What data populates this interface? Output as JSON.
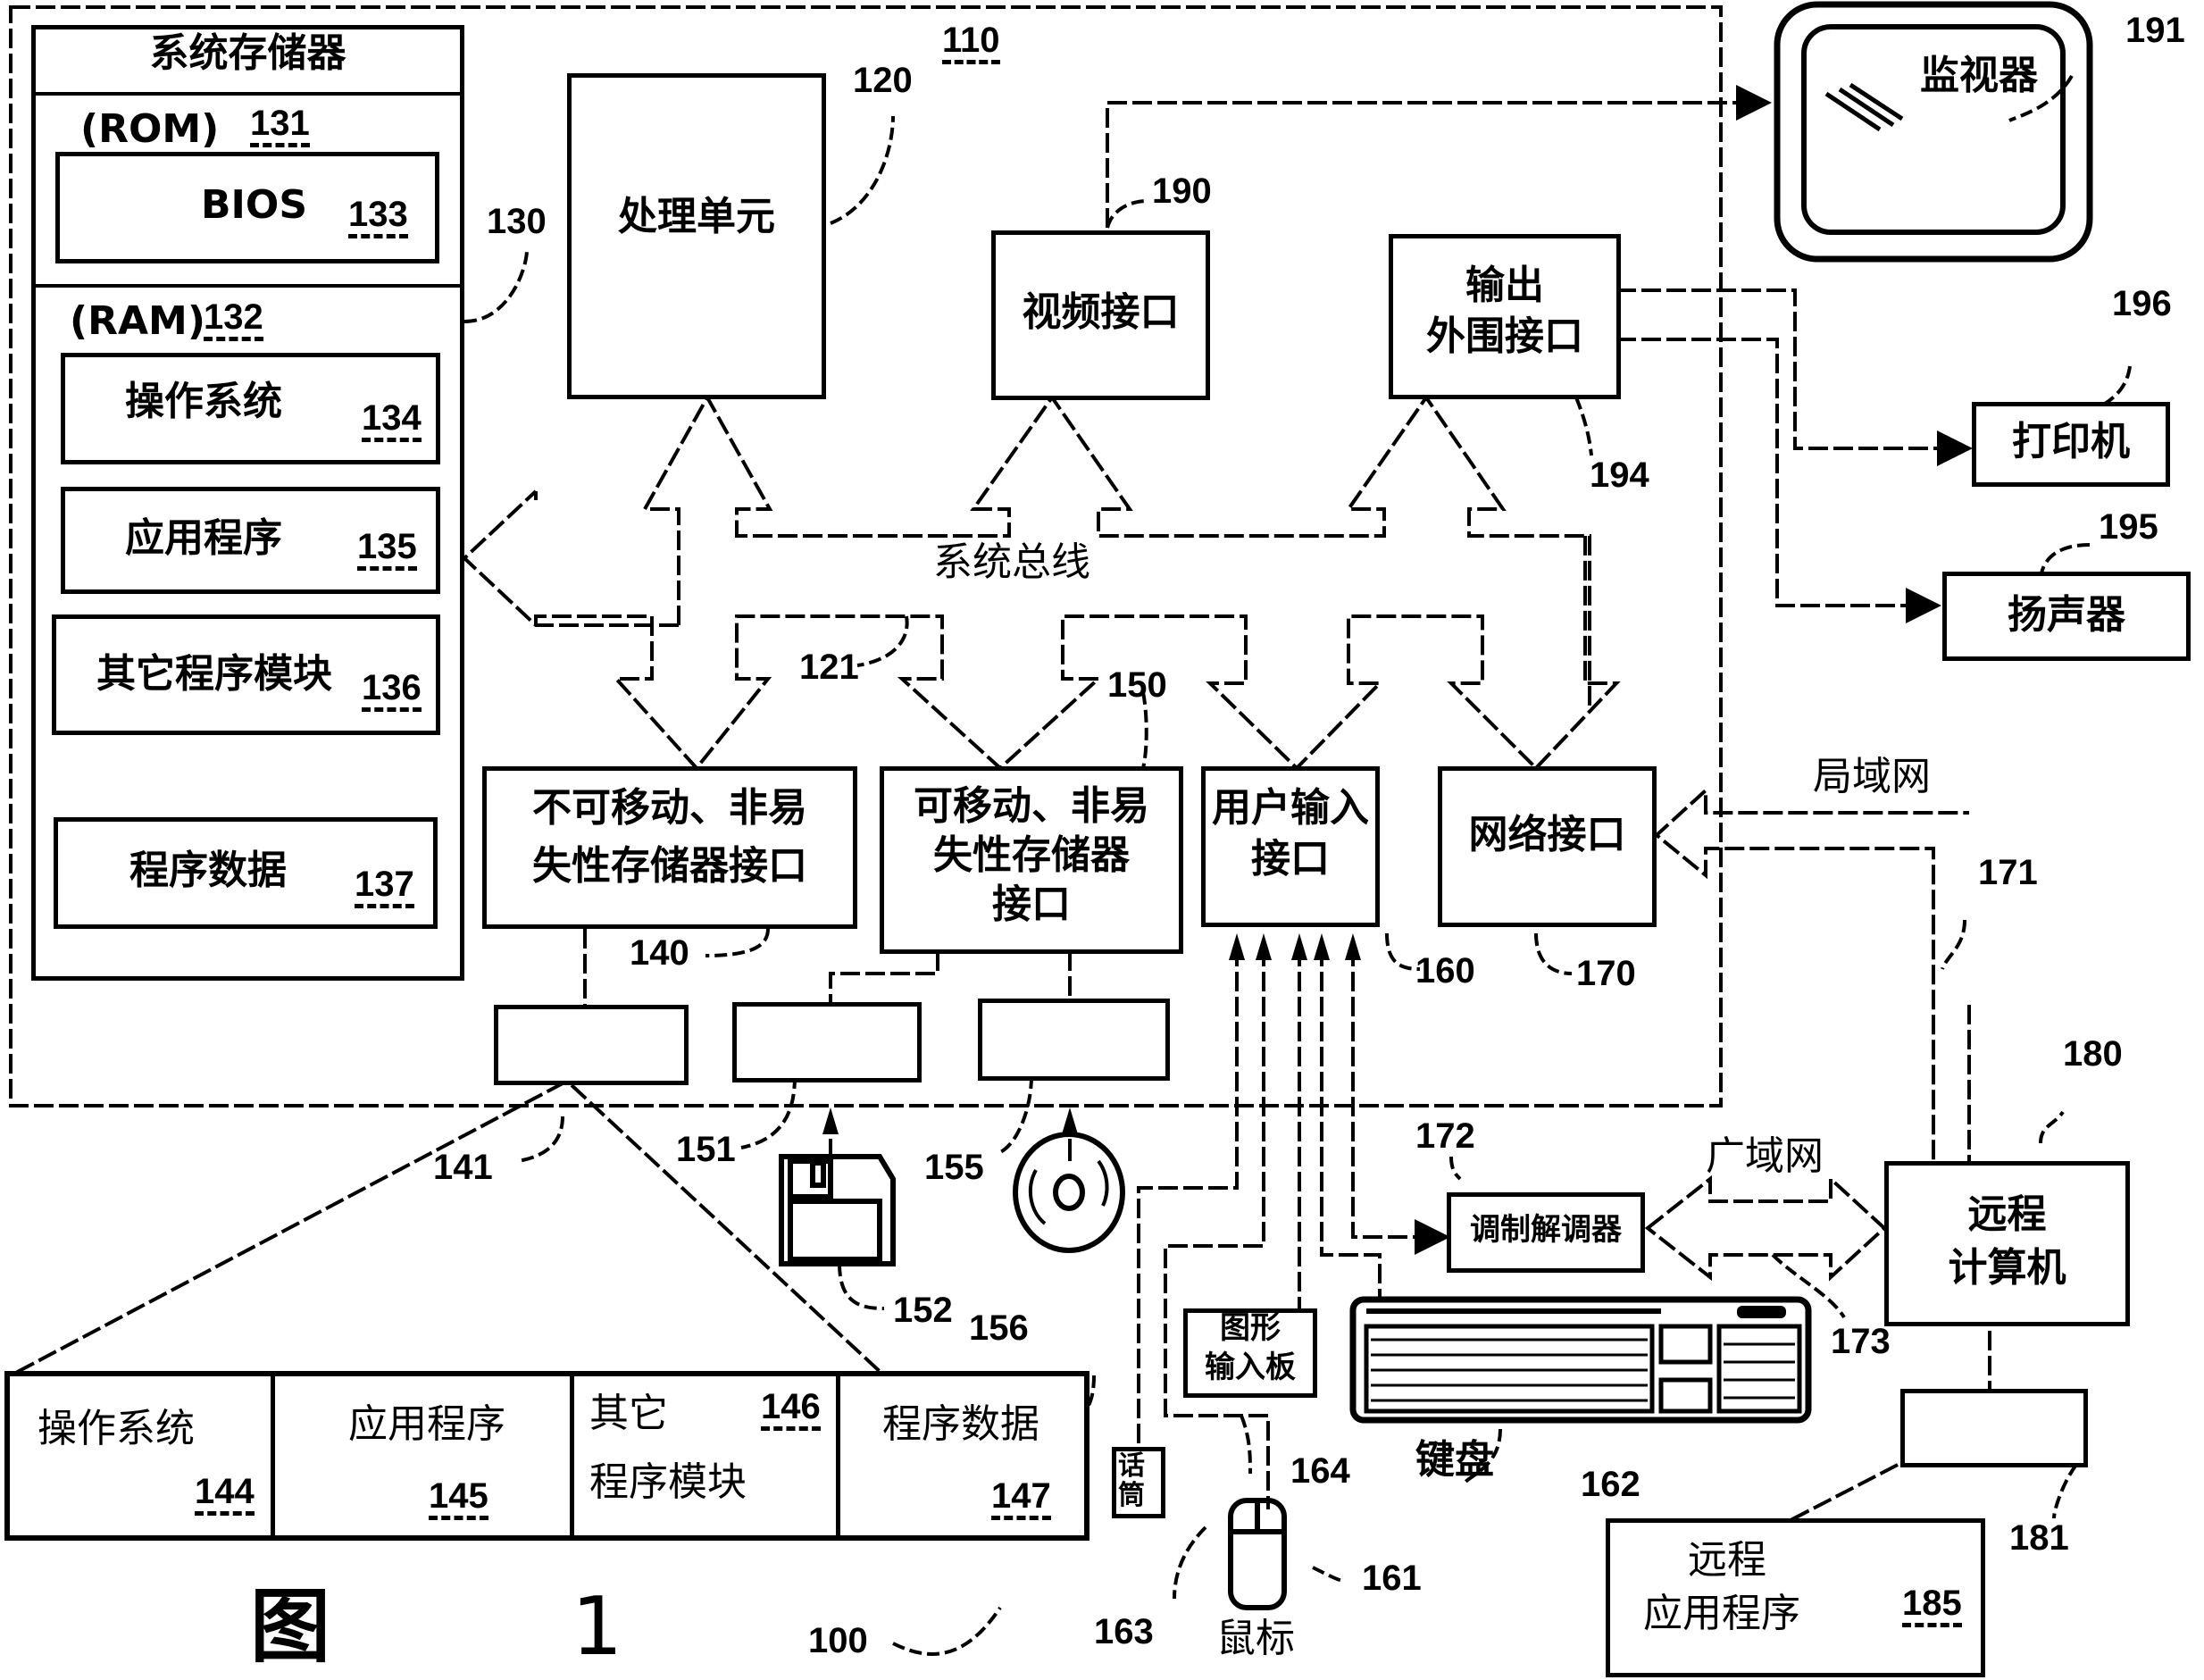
{
  "figure": {
    "caption_char": "图",
    "caption_number": "1",
    "system_ref": "100"
  },
  "computer": {
    "ref": "110"
  },
  "system_memory": {
    "title": "系统存储器",
    "ref": "130",
    "rom": {
      "label": "(ROM)",
      "ref": "131"
    },
    "bios": {
      "label": "BIOS",
      "ref": "133"
    },
    "ram": {
      "label": "(RAM)",
      "ref": "132"
    },
    "items": [
      {
        "label": "操作系统",
        "ref": "134"
      },
      {
        "label": "应用程序",
        "ref": "135"
      },
      {
        "label": "其它程序模块",
        "ref": "136"
      },
      {
        "label": "程序数据",
        "ref": "137"
      }
    ]
  },
  "processing_unit": {
    "label": "处理单元",
    "ref": "120"
  },
  "video_interface": {
    "label": "视频接口",
    "ref": "190"
  },
  "output_peripheral": {
    "line1": "输出",
    "line2": "外围接口",
    "ref": "194"
  },
  "monitor": {
    "label": "监视器",
    "ref": "191"
  },
  "printer": {
    "label": "打印机",
    "ref": "196"
  },
  "speaker": {
    "label": "扬声器",
    "ref": "195"
  },
  "system_bus": {
    "label": "系统总线",
    "ref": "121"
  },
  "nonremovable_if": {
    "line1": "不可移动、非易",
    "line2": "失性存储器接口",
    "ref": "140"
  },
  "removable_if": {
    "line1": "可移动、非易",
    "line2": "失性存储器",
    "line3": "接口",
    "ref": "150"
  },
  "user_input_if": {
    "line1": "用户输入",
    "line2": "接口",
    "ref": "160"
  },
  "network_if": {
    "label": "网络接口",
    "ref": "170"
  },
  "lan": {
    "label": "局域网",
    "ref": "171"
  },
  "wan": {
    "label": "广域网",
    "ref": "173"
  },
  "modem": {
    "label": "调制解调器",
    "ref": "172"
  },
  "remote_computer": {
    "line1": "远程",
    "line2": "计算机",
    "ref": "180"
  },
  "remote_storage": {
    "ref": "181"
  },
  "remote_apps": {
    "line1": "远程",
    "line2": "应用程序",
    "ref": "185"
  },
  "hard_disk": {
    "ref": "141"
  },
  "floppy_drive": {
    "ref": "151"
  },
  "floppy_disk": {
    "ref": "152"
  },
  "optical_drive": {
    "ref": "155"
  },
  "optical_disk": {
    "ref": "156"
  },
  "tablet": {
    "line1": "图形",
    "line2": "输入板",
    "ref": "164"
  },
  "microphone": {
    "label": "话筒",
    "ref": "163"
  },
  "mouse": {
    "label": "鼠标",
    "ref": "161"
  },
  "keyboard": {
    "label": "键盘",
    "ref": "162"
  },
  "disk_contents": [
    {
      "label": "操作系统",
      "ref": "144"
    },
    {
      "label": "应用程序",
      "ref": "145"
    },
    {
      "line1": "其它",
      "line2": "程序模块",
      "ref": "146"
    },
    {
      "label": "程序数据",
      "ref": "147"
    }
  ]
}
